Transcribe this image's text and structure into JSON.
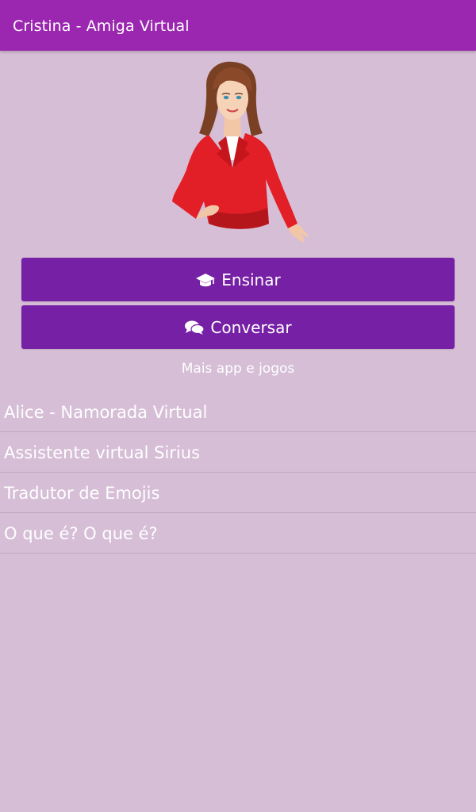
{
  "app_bar": {
    "title": "Cristina - Amiga Virtual",
    "color": "#9b27b0"
  },
  "avatar": {
    "icon": "woman-red-jacket-avatar"
  },
  "buttons": {
    "teach": {
      "label": "Ensinar",
      "icon": "graduation-cap-icon"
    },
    "chat": {
      "label": "Conversar",
      "icon": "chat-bubbles-icon"
    },
    "color": "#7620a5"
  },
  "more_apps": {
    "label": "Mais app e jogos",
    "items": [
      {
        "label": "Alice - Namorada Virtual"
      },
      {
        "label": "Assistente virtual Sirius"
      },
      {
        "label": "Tradutor de Emojis"
      },
      {
        "label": "O que é? O que é?"
      }
    ]
  },
  "background_color": "#d6bed6"
}
